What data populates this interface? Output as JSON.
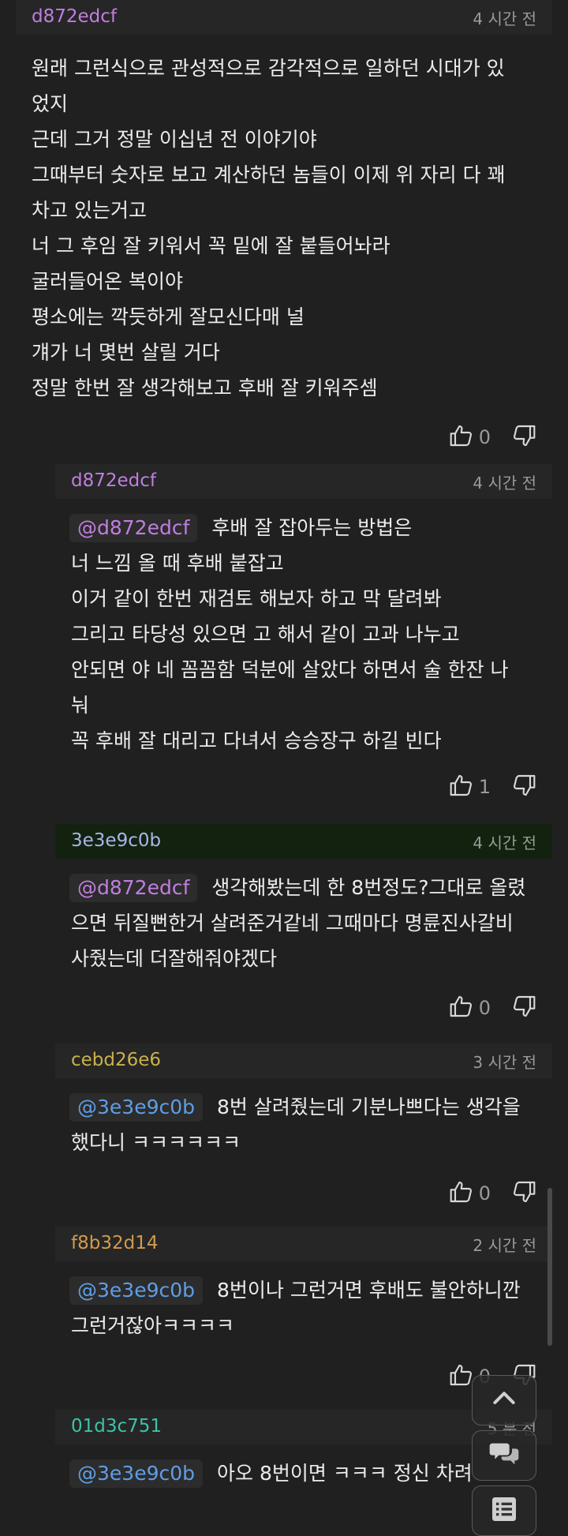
{
  "comments": [
    {
      "user": "d872edcf",
      "user_color": "#c07ee0",
      "time": "4 시간 전",
      "lines": [
        "원래 그런식으로 관성적으로 감각적으로 일하던 시대가 있",
        "었지",
        "근데 그거 정말 이십년 전 이야기야",
        "그때부터 숫자로 보고 계산하던 놈들이 이제 위 자리 다 꽤",
        "차고 있는거고",
        "너 그 후임 잘 키워서 꼭 밑에 잘 붙들어놔라",
        "굴러들어온 복이야",
        "평소에는 깍듯하게 잘모신다매 널",
        "걔가 너 몇번 살릴 거다",
        "정말 한번 잘 생각해보고 후배 잘 키워주셈"
      ],
      "likes": "0"
    },
    {
      "user": "d872edcf",
      "user_color": "#c07ee0",
      "time": "4 시간 전",
      "mention": "@d872edcf",
      "mention_color": "#c07ee0",
      "first_line": "후배 잘 잡아두는 방법은",
      "lines": [
        "너 느낌 올 때 후배 붙잡고",
        "이거 같이 한번 재검토 해보자 하고 막 달려봐",
        "그리고 타당성 있으면 고 해서 같이 고과 나누고",
        "안되면 야 네 꼼꼼함 덕분에 살았다 하면서 술 한잔 나",
        "눠",
        "꼭 후배 잘 대리고 다녀서 승승장구 하길 빈다"
      ],
      "likes": "1"
    },
    {
      "user": "3e3e9c0b",
      "user_color": "#a8b7e8",
      "time": "4 시간 전",
      "mention": "@d872edcf",
      "mention_color": "#c07ee0",
      "first_line": "생각해봤는데 한 8번정도?그대로 올렸",
      "lines": [
        "으면 뒤질뻔한거 살려준거같네 그때마다 명륜진사갈비",
        "사줬는데 더잘해줘야겠다"
      ],
      "likes": "0"
    },
    {
      "user": "cebd26e6",
      "user_color": "#c9b24a",
      "time": "3 시간 전",
      "mention": "@3e3e9c0b",
      "mention_color": "#5f9ee6",
      "first_line": "8번 살려줬는데 기분나쁘다는 생각을",
      "lines": [
        "했다니 ㅋㅋㅋㅋㅋㅋ"
      ],
      "likes": "0"
    },
    {
      "user": "f8b32d14",
      "user_color": "#d29a4e",
      "time": "2 시간 전",
      "mention": "@3e3e9c0b",
      "mention_color": "#5f9ee6",
      "first_line": "8번이나 그런거면 후배도 불안하니깐",
      "lines": [
        "그런거잖아ㅋㅋㅋㅋ"
      ],
      "likes": "0"
    },
    {
      "user": "01d3c751",
      "user_color": "#3cc3a8",
      "time": "5 분 전",
      "mention": "@3e3e9c0b",
      "mention_color": "#5f9ee6",
      "first_line": "아오 8번이면 ㅋㅋㅋ 정신 차려"
    }
  ],
  "icons": {
    "like": "thumbs-up-icon",
    "dislike": "thumbs-down-icon",
    "fab_top": "chevron-up-icon",
    "fab_chat": "chat-bubbles-icon",
    "fab_list": "list-icon"
  }
}
